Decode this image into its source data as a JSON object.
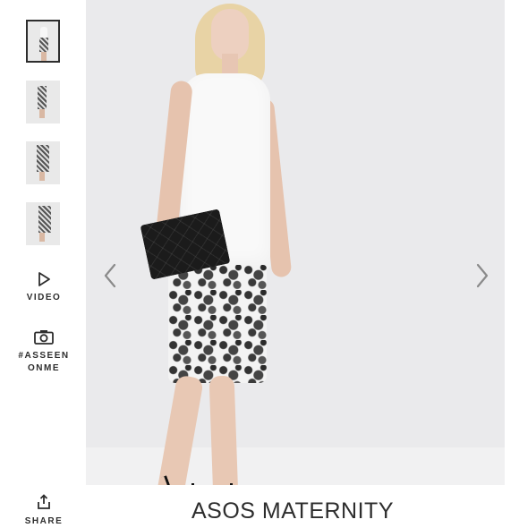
{
  "rail": {
    "thumbnails": [
      {
        "name": "thumbnail-1",
        "active": true
      },
      {
        "name": "thumbnail-2",
        "active": false
      },
      {
        "name": "thumbnail-3",
        "active": false
      },
      {
        "name": "thumbnail-4",
        "active": false
      }
    ],
    "video_label": "VIDEO",
    "video_icon": "play-icon",
    "asseenonme_label": "#ASSEEN ONME",
    "asseenonme_icon": "camera-icon",
    "share_label": "SHARE",
    "share_icon": "share-icon"
  },
  "gallery": {
    "prev_icon": "chevron-left-icon",
    "next_icon": "chevron-right-icon"
  },
  "product": {
    "brand": "ASOS MATERNITY"
  }
}
